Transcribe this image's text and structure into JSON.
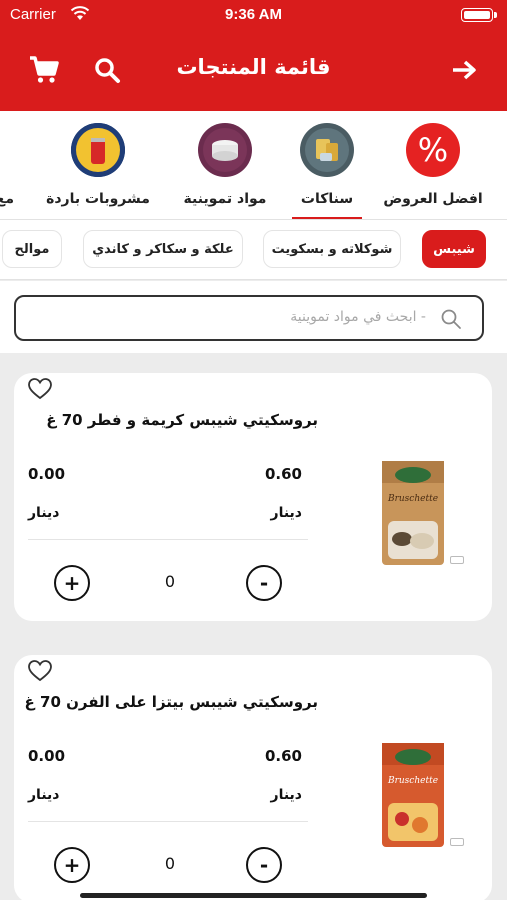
{
  "status": {
    "carrier": "Carrier",
    "time": "9:36 AM"
  },
  "header": {
    "title": "قائمة المنتجات"
  },
  "categories": [
    {
      "label": "افضل العروض",
      "icon": "percent-icon"
    },
    {
      "label": "سناكات",
      "icon": "snacks-icon",
      "active": true
    },
    {
      "label": "مواد تموينية",
      "icon": "groceries-icon"
    },
    {
      "label": "مشروبات باردة",
      "icon": "cold-drinks-icon"
    },
    {
      "label": "مع",
      "icon": "partial-category"
    }
  ],
  "chips": [
    {
      "label": "شيبس",
      "active": true
    },
    {
      "label": "شوكلاته و بسكويت"
    },
    {
      "label": "علكة و سكاكر و كاندي"
    },
    {
      "label": "موالح"
    }
  ],
  "search": {
    "placeholder": "ابحث في مواد تموينية -"
  },
  "products": [
    {
      "name": "بروسكيتي شيبس كريمة و فطر 70 غ",
      "price": "0.60",
      "price_currency": "دينار",
      "total": "0.00",
      "total_currency": "دينار",
      "qty": "0",
      "image_label": "Bruschette"
    },
    {
      "name": "بروسكيتي شيبس بيتزا على الفرن 70 غ",
      "price": "0.60",
      "price_currency": "دينار",
      "total": "0.00",
      "total_currency": "دينار",
      "qty": "0",
      "image_label": "Bruschette"
    }
  ],
  "colors": {
    "accent": "#d91c1c",
    "background": "#ececec"
  }
}
